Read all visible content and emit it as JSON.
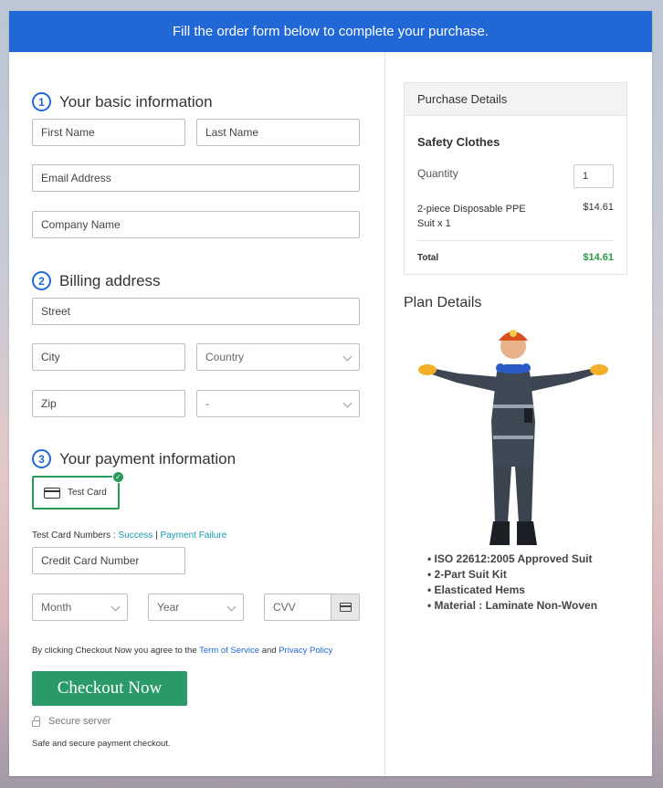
{
  "banner": {
    "text": "Fill the order form below to complete your purchase."
  },
  "basic_info": {
    "number": "1",
    "title": "Your basic information",
    "first_name": "First Name",
    "last_name": "Last Name",
    "email": "Email Address",
    "company": "Company Name"
  },
  "billing": {
    "number": "2",
    "title": "Billing address",
    "street": "Street",
    "city": "City",
    "country": "Country",
    "zip": "Zip",
    "state": "-"
  },
  "payment": {
    "number": "3",
    "title": "Your payment information",
    "card_option": "Test Card",
    "test_numbers_label": "Test Card Numbers : ",
    "success": "Success",
    "separator": "|",
    "failure": "Payment Failure",
    "card_number": "Credit Card Number",
    "month": "Month",
    "year": "Year",
    "cvv": "CVV"
  },
  "agreement": {
    "prefix": "By clicking Checkout Now you agree to the ",
    "terms": "Term of Service",
    "and": " and ",
    "privacy": "Privacy Policy"
  },
  "checkout": {
    "button": "Checkout Now",
    "secure": "Secure server",
    "note": "Safe and secure payment checkout."
  },
  "purchase": {
    "header": "Purchase Details",
    "product": "Safety Clothes",
    "quantity_label": "Quantity",
    "quantity": "1",
    "item_line1": "2-piece Disposable PPE",
    "item_line2": "Suit x 1",
    "item_price": "$14.61",
    "total_label": "Total",
    "total": "$14.61"
  },
  "plan": {
    "title": "Plan Details",
    "features": [
      "ISO 22612:2005 Approved Suit",
      "2-Part Suit Kit",
      "Elasticated Hems",
      "Material : Laminate Non-Woven"
    ]
  },
  "colors": {
    "banner": "#2168d6",
    "accent_green": "#2a9a68",
    "total_green": "#2a9a4a",
    "link": "#1a9ab0"
  }
}
